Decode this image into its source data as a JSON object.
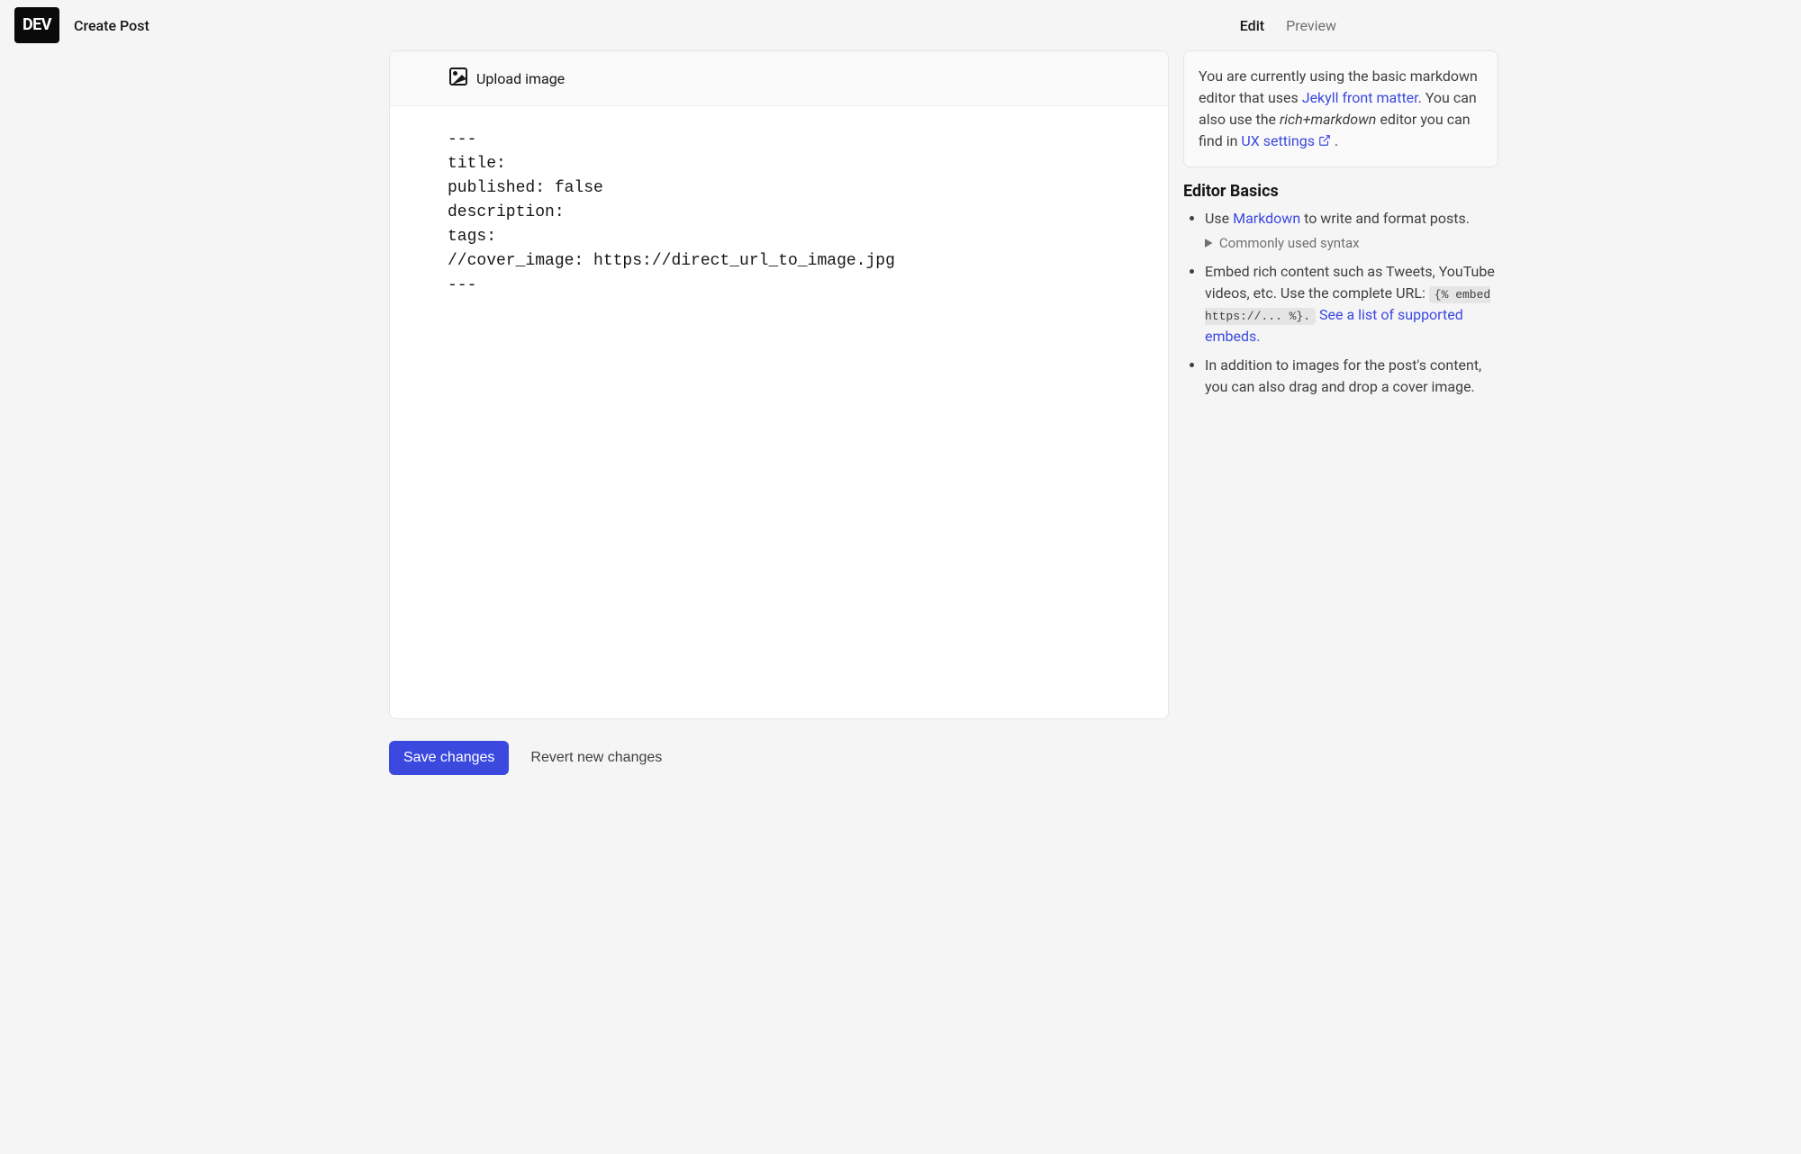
{
  "header": {
    "logo_text": "DEV",
    "title": "Create Post",
    "tabs": {
      "edit": "Edit",
      "preview": "Preview"
    }
  },
  "editor": {
    "upload_label": "Upload image",
    "content": "---\ntitle: \npublished: false\ndescription: \ntags: \n//cover_image: https://direct_url_to_image.jpg\n---\n"
  },
  "info_box": {
    "text_before_link1": "You are currently using the basic markdown editor that uses ",
    "link1": "Jekyll front matter",
    "text_after_link1": ". You can also use the ",
    "em_text": "rich+markdown",
    "text_after_em": " editor you can find in ",
    "link2": "UX settings",
    "text_end": " ."
  },
  "sidebar": {
    "heading": "Editor Basics",
    "items": {
      "item1_before": "Use ",
      "item1_link": "Markdown",
      "item1_after": " to write and format posts.",
      "item1_details": "Commonly used syntax",
      "item2_line1": "Embed rich content such as Tweets, YouTube videos, etc. Use the complete URL: ",
      "item2_code": "{% embed https://... %}.",
      "item2_link": "See a list of supported embeds.",
      "item3": "In addition to images for the post's content, you can also drag and drop a cover image."
    }
  },
  "footer": {
    "save": "Save changes",
    "revert": "Revert new changes"
  }
}
